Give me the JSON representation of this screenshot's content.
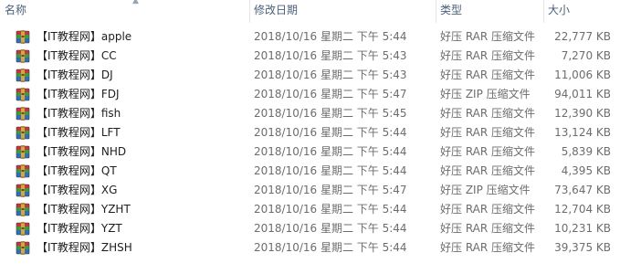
{
  "columns": {
    "name": "名称",
    "date": "修改日期",
    "type": "类型",
    "size": "大小"
  },
  "files": [
    {
      "name": "【IT教程网】apple",
      "date": "2018/10/16 星期二 下午 5:44",
      "type": "好压 RAR 压缩文件",
      "size": "22,777 KB"
    },
    {
      "name": "【IT教程网】CC",
      "date": "2018/10/16 星期二 下午 5:43",
      "type": "好压 RAR 压缩文件",
      "size": "7,270 KB"
    },
    {
      "name": "【IT教程网】DJ",
      "date": "2018/10/16 星期二 下午 5:43",
      "type": "好压 RAR 压缩文件",
      "size": "11,006 KB"
    },
    {
      "name": "【IT教程网】FDJ",
      "date": "2018/10/16 星期二 下午 5:47",
      "type": "好压 ZIP 压缩文件",
      "size": "94,011 KB"
    },
    {
      "name": "【IT教程网】fish",
      "date": "2018/10/16 星期二 下午 5:45",
      "type": "好压 RAR 压缩文件",
      "size": "12,390 KB"
    },
    {
      "name": "【IT教程网】LFT",
      "date": "2018/10/16 星期二 下午 5:44",
      "type": "好压 RAR 压缩文件",
      "size": "13,124 KB"
    },
    {
      "name": "【IT教程网】NHD",
      "date": "2018/10/16 星期二 下午 5:44",
      "type": "好压 RAR 压缩文件",
      "size": "5,839 KB"
    },
    {
      "name": "【IT教程网】QT",
      "date": "2018/10/16 星期二 下午 5:44",
      "type": "好压 RAR 压缩文件",
      "size": "4,395 KB"
    },
    {
      "name": "【IT教程网】XG",
      "date": "2018/10/16 星期二 下午 5:47",
      "type": "好压 ZIP 压缩文件",
      "size": "73,647 KB"
    },
    {
      "name": "【IT教程网】YZHT",
      "date": "2018/10/16 星期二 下午 5:44",
      "type": "好压 RAR 压缩文件",
      "size": "12,704 KB"
    },
    {
      "name": "【IT教程网】YZT",
      "date": "2018/10/16 星期二 下午 5:44",
      "type": "好压 RAR 压缩文件",
      "size": "10,231 KB"
    },
    {
      "name": "【IT教程网】ZHSH",
      "date": "2018/10/16 星期二 下午 5:44",
      "type": "好压 RAR 压缩文件",
      "size": "39,375 KB"
    }
  ],
  "icon": "archive-file-icon",
  "colors": {
    "header_text": "#4c607a",
    "secondary_text": "#6d6d6d",
    "primary_text": "#1e1e1e",
    "separator": "#e5e5e5"
  }
}
